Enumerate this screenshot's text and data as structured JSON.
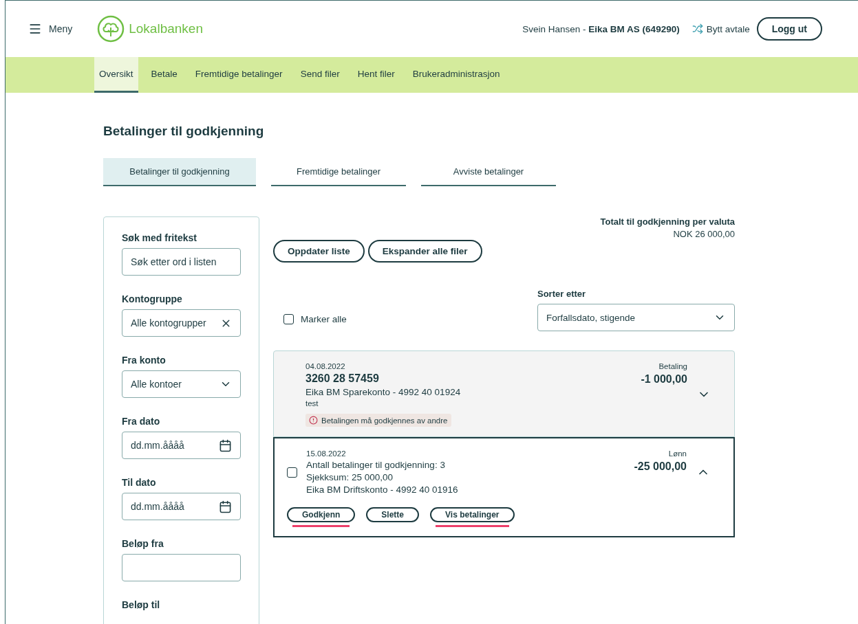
{
  "header": {
    "menu_label": "Meny",
    "logo_text": "Lokalbanken",
    "user": "Svein Hansen - ",
    "company": "Eika BM AS (649290)",
    "switch_label": "Bytt avtale",
    "logout": "Logg ut"
  },
  "nav": [
    {
      "label": "Oversikt",
      "selected": true
    },
    {
      "label": "Betale",
      "selected": false
    },
    {
      "label": "Fremtidige betalinger",
      "selected": false
    },
    {
      "label": "Send filer",
      "selected": false
    },
    {
      "label": "Hent filer",
      "selected": false
    },
    {
      "label": "Brukeradministrasjon",
      "selected": false
    }
  ],
  "page_title": "Betalinger til godkjenning",
  "tabs": [
    {
      "label": "Betalinger til godkjenning",
      "selected": true
    },
    {
      "label": "Fremtidige betalinger",
      "selected": false
    },
    {
      "label": "Avviste betalinger",
      "selected": false
    }
  ],
  "filters": [
    {
      "kind": "text",
      "label": "Søk med fritekst",
      "placeholder": "Søk etter ord i listen"
    },
    {
      "kind": "clearable",
      "label": "Kontogruppe",
      "value": "Alle kontogrupper"
    },
    {
      "kind": "select",
      "label": "Fra konto",
      "value": "Alle kontoer"
    },
    {
      "kind": "date",
      "label": "Fra dato",
      "placeholder": "dd.mm.åååå"
    },
    {
      "kind": "date",
      "label": "Til dato",
      "placeholder": "dd.mm.åååå"
    },
    {
      "kind": "text",
      "label": "Beløp fra"
    },
    {
      "kind": "label",
      "label": "Beløp til"
    }
  ],
  "totals": {
    "title": "Totalt til godkjenning per valuta",
    "value": "NOK 26 000,00"
  },
  "buttons": [
    "Oppdater liste",
    "Ekspander alle filer"
  ],
  "select_all": {
    "label": "Marker alle",
    "checked": false
  },
  "sort": {
    "label": "Sorter etter",
    "value": "Forfallsdato, stigende"
  },
  "items": [
    {
      "kind": "payment",
      "expanded": false,
      "date": "04.08.2022",
      "title": "3260 28 57459",
      "lines": [
        "Eika BM Sparekonto - 4992 40 01924"
      ],
      "note": "test",
      "warning": "Betalingen må godkjennes av andre",
      "type": "Betaling",
      "amount": "-1 000,00"
    },
    {
      "kind": "file",
      "expanded": true,
      "checked": false,
      "date": "15.08.2022",
      "lines": [
        "Antall betalinger til godkjenning: 3",
        "Sjekksum: 25 000,00",
        "Eika BM Driftskonto - 4992 40 01916"
      ],
      "type": "Lønn",
      "amount": "-25 000,00",
      "actions": [
        {
          "label": "Godkjenn",
          "highlighted": true
        },
        {
          "label": "Slette",
          "highlighted": false
        },
        {
          "label": "Vis betalinger",
          "highlighted": true
        }
      ]
    }
  ]
}
